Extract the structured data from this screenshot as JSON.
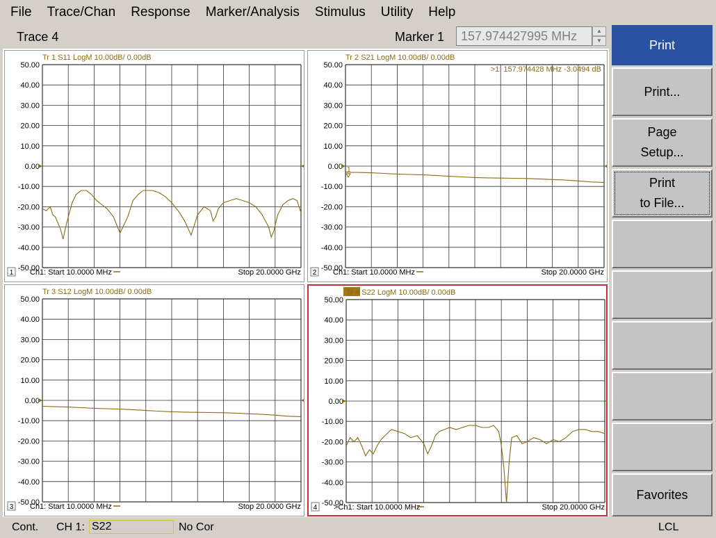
{
  "menu": [
    "File",
    "Trace/Chan",
    "Response",
    "Marker/Analysis",
    "Stimulus",
    "Utility",
    "Help"
  ],
  "entry": {
    "title": "Trace 4",
    "marker_label": "Marker 1",
    "marker_value": "157.974427995 MHz"
  },
  "softkeys": {
    "header": "Print",
    "items": [
      {
        "lines": [
          "Print..."
        ]
      },
      {
        "lines": [
          "Page",
          "Setup..."
        ]
      },
      {
        "lines": [
          "Print",
          "to File..."
        ]
      },
      {
        "lines": []
      },
      {
        "lines": []
      },
      {
        "lines": []
      },
      {
        "lines": []
      },
      {
        "lines": []
      }
    ],
    "favorites": "Favorites"
  },
  "status": {
    "mode": "Cont.",
    "channel": "CH 1:",
    "measurement": "S22",
    "correction": "No Cor",
    "lcl": "LCL"
  },
  "colors": {
    "trace": "#8a6a10",
    "grid": "#333333",
    "active_border": "#c0303a",
    "tr4_badge": "#a07818",
    "softkey_header": "#2a52a2"
  },
  "chart_data": [
    {
      "type": "line",
      "window": "1",
      "active": false,
      "title": "Tr 1  S11 LogM 10.00dB/  0.00dB",
      "ylim": [
        -50,
        50
      ],
      "yticks": [
        "50.00",
        "40.00",
        "30.00",
        "20.00",
        "10.00",
        "0.00",
        "-10.00",
        "-20.00",
        "-30.00",
        "-40.00",
        "-50.00"
      ],
      "xlim_label": [
        "Ch1: Start  10.0000 MHz",
        "Stop  20.0000 GHz"
      ],
      "marker_readout": "",
      "series": [
        {
          "x": [
            0.01,
            0.3,
            0.6,
            0.8,
            1.0,
            1.2,
            1.4,
            1.6,
            1.8,
            2.0,
            2.3,
            2.6,
            3.0,
            3.4,
            3.8,
            4.2,
            4.6,
            5.0,
            5.5,
            6.0,
            6.6,
            7.0,
            7.4,
            7.6,
            7.8,
            8.0,
            8.5,
            9.0,
            9.5,
            10.0,
            10.5,
            11.0,
            11.5,
            12.0,
            12.5,
            13.0,
            13.2,
            13.4,
            13.6,
            14.0,
            14.5,
            15.0,
            15.5,
            16.0,
            16.5,
            17.0,
            17.5,
            17.7,
            17.9,
            18.2,
            18.6,
            19.0,
            19.4,
            19.7,
            20.0
          ],
          "y": [
            -21,
            -22,
            -20,
            -24,
            -25,
            -28,
            -31,
            -36,
            -30,
            -25,
            -18,
            -14,
            -12,
            -12,
            -14,
            -17,
            -19,
            -21,
            -25,
            -33,
            -25,
            -17,
            -14,
            -13,
            -12,
            -12,
            -12,
            -13,
            -15,
            -18,
            -22,
            -27,
            -34,
            -24,
            -20,
            -22,
            -27,
            -25,
            -21,
            -18,
            -17,
            -16,
            -17,
            -18,
            -20,
            -24,
            -30,
            -35,
            -32,
            -24,
            -19,
            -17,
            -16,
            -17,
            -23
          ]
        }
      ]
    },
    {
      "type": "line",
      "window": "2",
      "active": false,
      "title": "Tr 2  S21 LogM 10.00dB/  0.00dB",
      "ylim": [
        -50,
        50
      ],
      "yticks": [
        "50.00",
        "40.00",
        "30.00",
        "20.00",
        "10.00",
        "0.00",
        "-10.00",
        "-20.00",
        "-30.00",
        "-40.00",
        "-50.00"
      ],
      "xlim_label": [
        "Ch1: Start  10.0000 MHz",
        "Stop  20.0000 GHz"
      ],
      "marker_readout": ">1:  157.974428 MHz     -3.0494 dB",
      "series": [
        {
          "x": [
            0.01,
            0.16,
            1,
            2,
            3,
            4,
            5,
            6,
            7,
            8,
            9,
            10,
            11,
            12,
            13,
            14,
            15,
            16,
            17,
            18,
            19,
            20
          ],
          "y": [
            -2.8,
            -3.05,
            -3.1,
            -3.3,
            -3.6,
            -3.9,
            -4.1,
            -4.3,
            -4.6,
            -5.0,
            -5.3,
            -5.6,
            -5.8,
            -5.9,
            -6.0,
            -6.1,
            -6.3,
            -6.6,
            -6.9,
            -7.3,
            -7.8,
            -8.0
          ]
        }
      ]
    },
    {
      "type": "line",
      "window": "3",
      "active": false,
      "title": "Tr 3  S12 LogM 10.00dB/  0.00dB",
      "ylim": [
        -50,
        50
      ],
      "yticks": [
        "50.00",
        "40.00",
        "30.00",
        "20.00",
        "10.00",
        "0.00",
        "-10.00",
        "-20.00",
        "-30.00",
        "-40.00",
        "-50.00"
      ],
      "xlim_label": [
        "Ch1: Start  10.0000 MHz",
        "Stop  20.0000 GHz"
      ],
      "marker_readout": "",
      "series": [
        {
          "x": [
            0.01,
            1,
            2,
            3,
            4,
            5,
            6,
            7,
            8,
            9,
            10,
            11,
            12,
            13,
            14,
            15,
            16,
            17,
            18,
            19,
            20
          ],
          "y": [
            -2.9,
            -3.1,
            -3.3,
            -3.6,
            -3.9,
            -4.1,
            -4.3,
            -4.6,
            -5.0,
            -5.3,
            -5.6,
            -5.8,
            -5.9,
            -6.0,
            -6.1,
            -6.3,
            -6.6,
            -6.9,
            -7.3,
            -7.8,
            -8.0
          ]
        }
      ]
    },
    {
      "type": "line",
      "window": "4",
      "active": true,
      "title": "Tr 4  S22 LogM 10.00dB/  0.00dB",
      "ylim": [
        -50,
        50
      ],
      "yticks": [
        "50.00",
        "40.00",
        "30.00",
        "20.00",
        "10.00",
        "0.00",
        "-10.00",
        "-20.00",
        "-30.00",
        "-40.00",
        "-50.00"
      ],
      "xlim_label": [
        ">Ch1: Start  10.0000 MHz",
        "Stop  20.0000 GHz"
      ],
      "marker_readout": "",
      "series": [
        {
          "x": [
            0.01,
            0.3,
            0.6,
            0.9,
            1.2,
            1.5,
            1.8,
            2.1,
            2.4,
            2.7,
            3.0,
            3.5,
            4.0,
            4.5,
            5.0,
            5.5,
            6.0,
            6.3,
            6.6,
            6.9,
            7.2,
            7.6,
            8.0,
            8.5,
            9.0,
            9.5,
            10.0,
            10.5,
            11.0,
            11.4,
            11.8,
            12.0,
            12.2,
            12.4,
            12.6,
            12.8,
            13.2,
            13.6,
            14.0,
            14.5,
            15.0,
            15.5,
            16.0,
            16.5,
            17.0,
            17.5,
            18.0,
            18.5,
            19.0,
            19.5,
            20.0
          ],
          "y": [
            -22,
            -18,
            -20,
            -18,
            -22,
            -27,
            -24,
            -26,
            -22,
            -19,
            -17,
            -14,
            -15,
            -16,
            -18,
            -17,
            -21,
            -26,
            -22,
            -17,
            -15,
            -14,
            -13,
            -14,
            -13,
            -12,
            -12,
            -13,
            -13,
            -12,
            -15,
            -22,
            -33,
            -50,
            -30,
            -18,
            -17,
            -21,
            -20,
            -18,
            -19,
            -21,
            -19,
            -20,
            -18,
            -15,
            -14,
            -14,
            -15,
            -15,
            -16
          ]
        }
      ]
    }
  ]
}
